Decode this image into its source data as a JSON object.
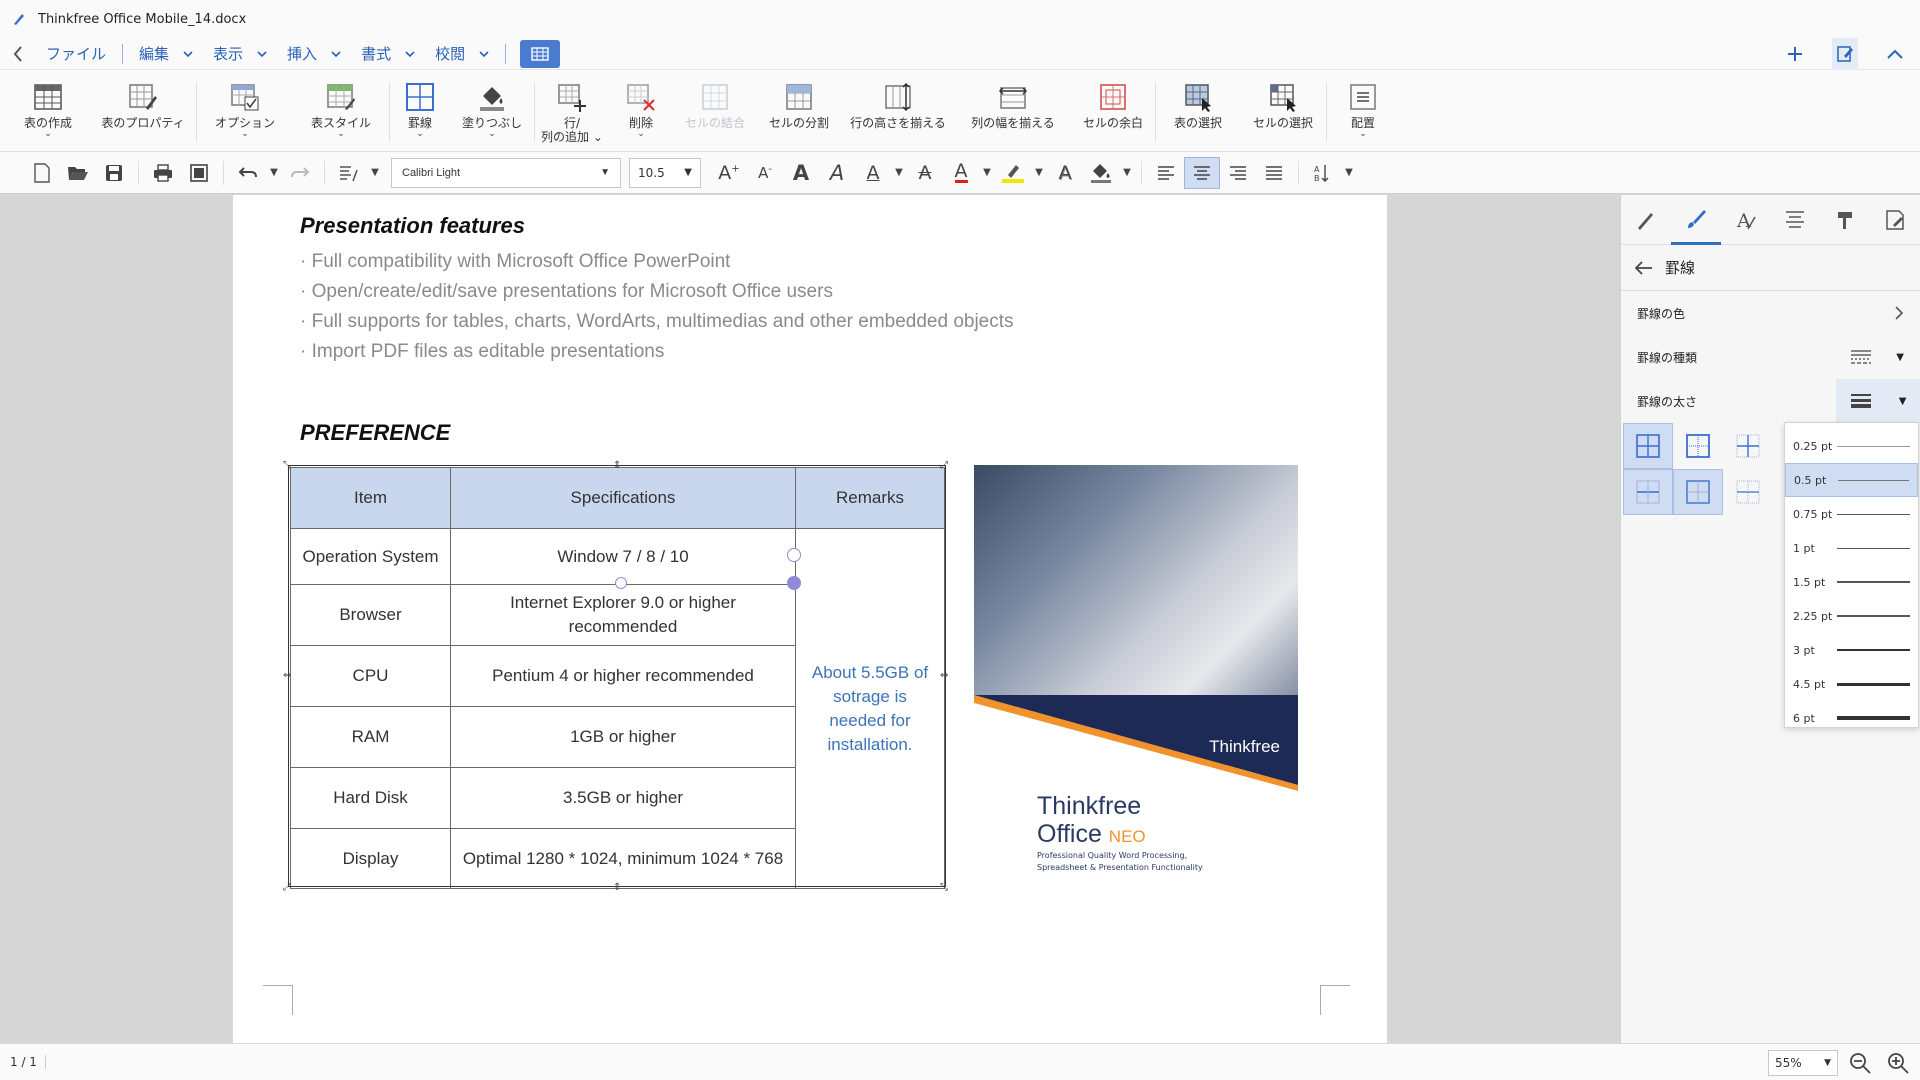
{
  "window": {
    "title": "Thinkfree Office Mobile_14.docx"
  },
  "menu": {
    "items": [
      {
        "label": "ファイル",
        "has_dropdown": false
      },
      {
        "label": "編集",
        "has_dropdown": true
      },
      {
        "label": "表示",
        "has_dropdown": true
      },
      {
        "label": "挿入",
        "has_dropdown": true
      },
      {
        "label": "書式",
        "has_dropdown": true
      },
      {
        "label": "校閲",
        "has_dropdown": true
      }
    ]
  },
  "ribbon": {
    "create_table": "表の作成",
    "table_properties": "表のプロパティ",
    "options": "オプション",
    "table_style": "表スタイル",
    "borders": "罫線",
    "shading": "塗りつぶし",
    "add_row_col_1": "行/",
    "add_row_col_2": "列の追加",
    "delete": "削除",
    "merge_cells": "セルの結合",
    "split_cells": "セルの分割",
    "equal_row_height": "行の高さを揃える",
    "equal_col_width": "列の幅を揃える",
    "cell_margin": "セルの余白",
    "select_table": "表の選択",
    "select_cell": "セルの選択",
    "align": "配置"
  },
  "format": {
    "font_name": "Calibri Light",
    "font_size": "10.5",
    "font_color": "#e02020",
    "highlight_color": "#f2e500",
    "alignment_active": "center"
  },
  "document": {
    "section1_heading": "Presentation features",
    "bullets": [
      "· Full compatibility with Microsoft Office PowerPoint",
      "· Open/create/edit/save presentations for Microsoft Office users",
      "· Full supports for tables, charts, WordArts, multimedias and other embedded objects",
      "· Import PDF files as editable presentations"
    ],
    "section2_heading": "PREFERENCE",
    "table": {
      "headers": [
        "Item",
        "Specifications",
        "Remarks"
      ],
      "rows": [
        [
          "Operation System",
          "Window 7 / 8 / 10"
        ],
        [
          "Browser",
          "Internet Explorer 9.0 or higher recommended"
        ],
        [
          "CPU",
          "Pentium 4 or higher recommended"
        ],
        [
          "RAM",
          "1GB or higher"
        ],
        [
          "Hard Disk",
          "3.5GB or higher"
        ],
        [
          "Display",
          "Optimal 1280 * 1024, minimum 1024 * 768"
        ]
      ],
      "remarks": "About 5.5GB of sotrage is needed for installation."
    },
    "cover": {
      "brand_line1": "Thinkfree",
      "brand_line2": "Office",
      "brand_neo": "NEO",
      "tagline1": "Professional Quality Word Processing,",
      "tagline2": "Spreadsheet & Presentation Functionality",
      "badge": "Thinkfree"
    }
  },
  "panel": {
    "title": "罫線",
    "border_color_label": "罫線の色",
    "border_style_label": "罫線の種類",
    "border_width_label": "罫線の太さ",
    "width_options": [
      "0.25 pt",
      "0.5 pt",
      "0.75 pt",
      "1 pt",
      "1.5 pt",
      "2.25 pt",
      "3 pt",
      "4.5 pt",
      "6 pt"
    ],
    "selected_width": "0.5 pt",
    "accent": "#2f6fc6"
  },
  "status": {
    "page_info": "1 / 1",
    "zoom": "55%"
  }
}
